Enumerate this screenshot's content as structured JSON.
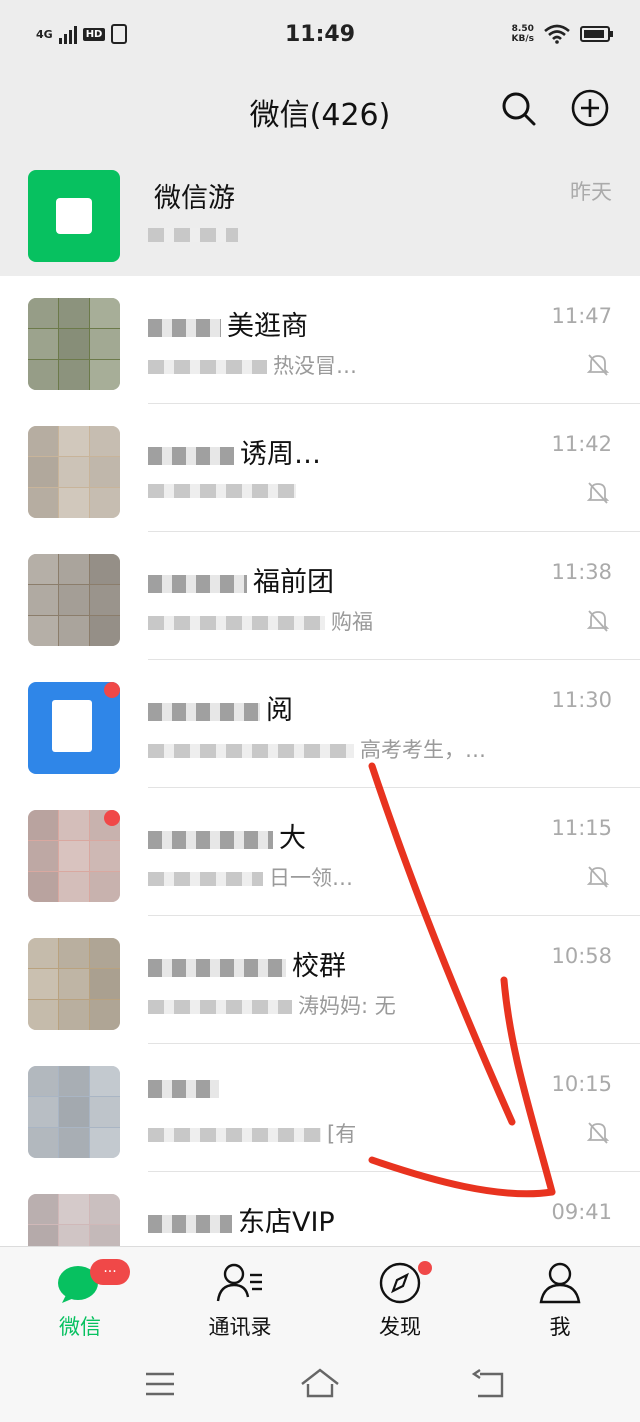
{
  "status_bar": {
    "time": "11:49",
    "network": "4G",
    "hd": "HD",
    "speed_value": "8.50",
    "speed_unit": "KB/s"
  },
  "header": {
    "title": "微信(426)",
    "search_icon": "search-icon",
    "add_icon": "plus-circle-icon"
  },
  "chats": [
    {
      "name": "微信游",
      "preview": "",
      "time": "昨天",
      "muted": false,
      "pinned": true,
      "avatar_color": "#07c160",
      "dot": false
    },
    {
      "name": "美逛商",
      "preview": "热没冒…",
      "time": "11:47",
      "muted": true,
      "pinned": false,
      "avatar_color": "#6c7a4a",
      "dot": false
    },
    {
      "name": "诱周…",
      "preview": "",
      "time": "11:42",
      "muted": true,
      "pinned": false,
      "avatar_color": "#c8b49a",
      "dot": false
    },
    {
      "name": "福前团",
      "preview": "购福",
      "time": "11:38",
      "muted": true,
      "pinned": false,
      "avatar_color": "#8b7d6b",
      "dot": false
    },
    {
      "name": "阅",
      "preview": "高考考生，…",
      "time": "11:30",
      "muted": false,
      "pinned": false,
      "avatar_color": "#2f86e8",
      "dot": true
    },
    {
      "name": "大",
      "preview": "日一领…",
      "time": "11:15",
      "muted": true,
      "pinned": false,
      "avatar_color": "#d9a8a0",
      "dot": true
    },
    {
      "name": "校群",
      "preview": "涛妈妈: 无",
      "time": "10:58",
      "muted": false,
      "pinned": false,
      "avatar_color": "#b9a27f",
      "dot": false
    },
    {
      "name": "",
      "preview": "[有",
      "time": "10:15",
      "muted": true,
      "pinned": false,
      "avatar_color": "#a9b5c4",
      "dot": false
    },
    {
      "name": "东店VIP",
      "preview": "",
      "time": "09:41",
      "muted": true,
      "pinned": false,
      "avatar_color": "#d0b8b8",
      "dot": false
    }
  ],
  "tabs": [
    {
      "label": "微信",
      "icon": "chat-bubble-icon",
      "active": true
    },
    {
      "label": "通讯录",
      "icon": "contacts-icon",
      "active": false
    },
    {
      "label": "发现",
      "icon": "compass-icon",
      "active": false
    },
    {
      "label": "我",
      "icon": "person-icon",
      "active": false
    }
  ],
  "unread_badge": "···",
  "colors": {
    "brand_green": "#07c160",
    "badge_red": "#f04848",
    "annotation_red": "#e8331f"
  }
}
